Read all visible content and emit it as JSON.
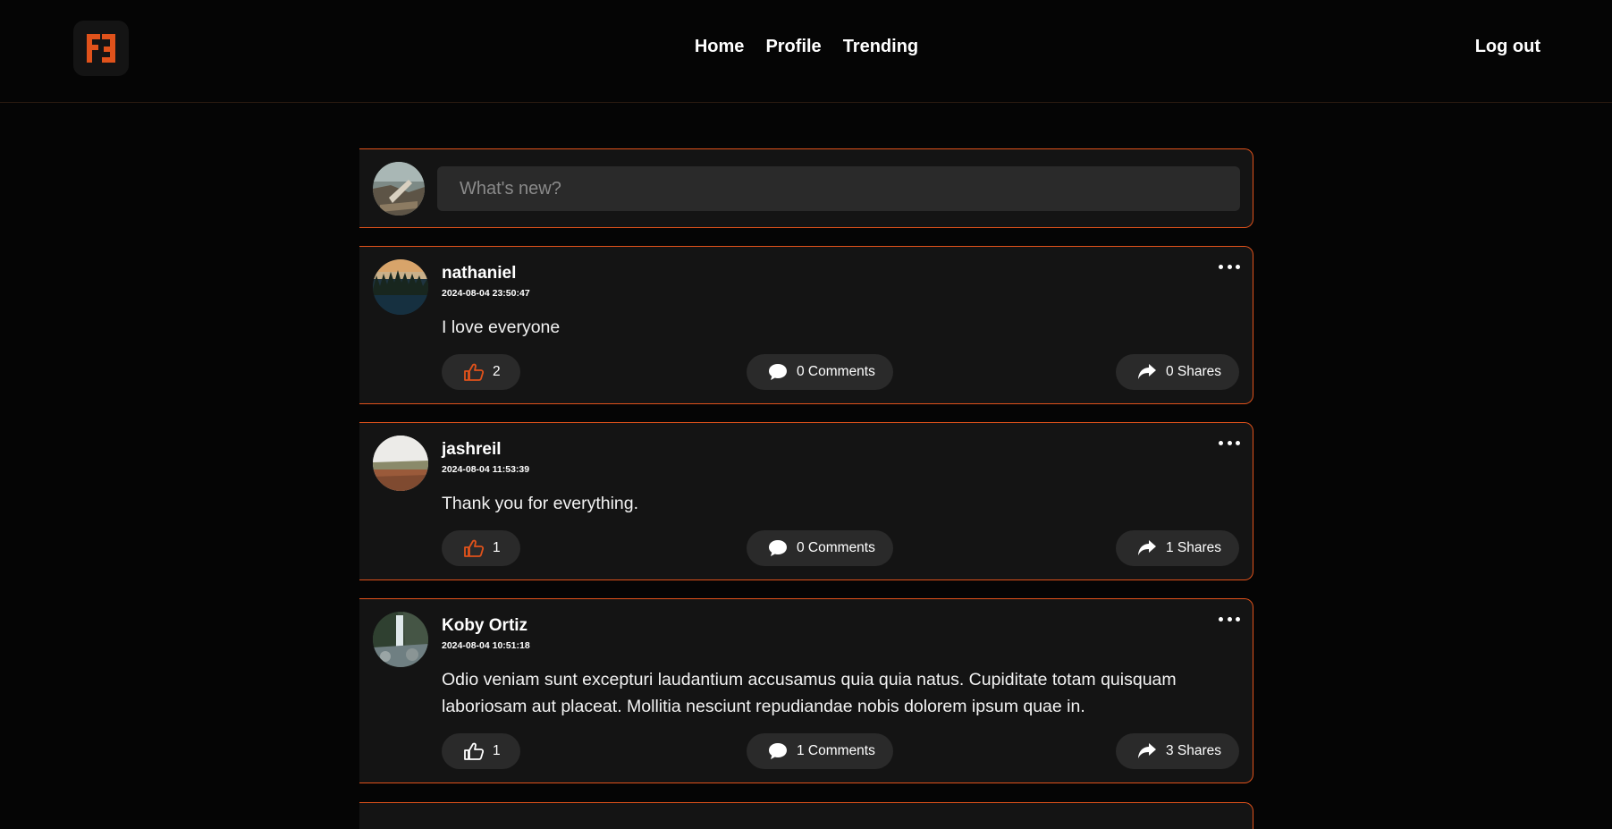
{
  "brand": {
    "logo_text": "FF",
    "accent": "#e0521b"
  },
  "nav": {
    "items": [
      {
        "label": "Home"
      },
      {
        "label": "Profile"
      },
      {
        "label": "Trending"
      }
    ],
    "logout_label": "Log out"
  },
  "composer": {
    "placeholder": "What's new?",
    "value": ""
  },
  "posts": [
    {
      "author": "nathaniel",
      "time": "2024-08-04 23:50:47",
      "body": "I love everyone",
      "likes": "2",
      "liked": true,
      "comments": "0 Comments",
      "shares": "0 Shares"
    },
    {
      "author": "jashreil",
      "time": "2024-08-04 11:53:39",
      "body": "Thank you for everything.",
      "likes": "1",
      "liked": true,
      "comments": "0 Comments",
      "shares": "1 Shares"
    },
    {
      "author": "Koby Ortiz",
      "time": "2024-08-04 10:51:18",
      "body": "Odio veniam sunt excepturi laudantium accusamus quia quia natus. Cupiditate totam quisquam laboriosam aut placeat. Mollitia nesciunt repudiandae nobis dolorem ipsum quae in.",
      "likes": "1",
      "liked": false,
      "comments": "1 Comments",
      "shares": "3 Shares"
    }
  ],
  "icons": {
    "like": "thumbs-up-icon",
    "comment": "speech-bubble-icon",
    "share": "share-arrow-icon",
    "more": "more-horizontal-icon"
  }
}
